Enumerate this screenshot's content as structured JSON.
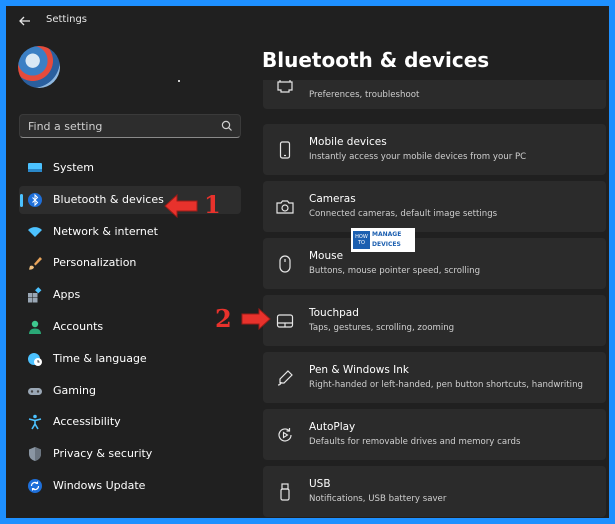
{
  "window": {
    "title": "Settings"
  },
  "search": {
    "placeholder": "Find a setting"
  },
  "nav": {
    "items": [
      {
        "label": "System",
        "icon": "monitor-icon",
        "active": false
      },
      {
        "label": "Bluetooth & devices",
        "icon": "bluetooth-icon",
        "active": true
      },
      {
        "label": "Network & internet",
        "icon": "wifi-icon",
        "active": false
      },
      {
        "label": "Personalization",
        "icon": "brush-icon",
        "active": false
      },
      {
        "label": "Apps",
        "icon": "apps-icon",
        "active": false
      },
      {
        "label": "Accounts",
        "icon": "person-icon",
        "active": false
      },
      {
        "label": "Time & language",
        "icon": "globe-clock-icon",
        "active": false
      },
      {
        "label": "Gaming",
        "icon": "gamepad-icon",
        "active": false
      },
      {
        "label": "Accessibility",
        "icon": "accessibility-icon",
        "active": false
      },
      {
        "label": "Privacy & security",
        "icon": "shield-icon",
        "active": false
      },
      {
        "label": "Windows Update",
        "icon": "update-icon",
        "active": false
      }
    ]
  },
  "page": {
    "title": "Bluetooth & devices"
  },
  "cards": [
    {
      "title": "",
      "subtitle": "Preferences, troubleshoot",
      "icon": "printer-icon"
    },
    {
      "title": "Mobile devices",
      "subtitle": "Instantly access your mobile devices from your PC",
      "icon": "phone-icon"
    },
    {
      "title": "Cameras",
      "subtitle": "Connected cameras, default image settings",
      "icon": "camera-icon"
    },
    {
      "title": "Mouse",
      "subtitle": "Buttons, mouse pointer speed, scrolling",
      "icon": "mouse-icon"
    },
    {
      "title": "Touchpad",
      "subtitle": "Taps, gestures, scrolling, zooming",
      "icon": "touchpad-icon"
    },
    {
      "title": "Pen & Windows Ink",
      "subtitle": "Right-handed or left-handed, pen button shortcuts, handwriting",
      "icon": "pen-icon"
    },
    {
      "title": "AutoPlay",
      "subtitle": "Defaults for removable drives and memory cards",
      "icon": "autoplay-icon"
    },
    {
      "title": "USB",
      "subtitle": "Notifications, USB battery saver",
      "icon": "usb-icon"
    }
  ],
  "annotations": {
    "step1": "1",
    "step2": "2",
    "marker_color": "#e8322c"
  },
  "watermark": {
    "how": "HOW TO",
    "manage": "MANAGE",
    "devices": "DEVICES"
  },
  "colors": {
    "accent": "#4cc2ff",
    "background": "#202020",
    "card": "#2b2b2b",
    "frame": "#1e90ff"
  }
}
